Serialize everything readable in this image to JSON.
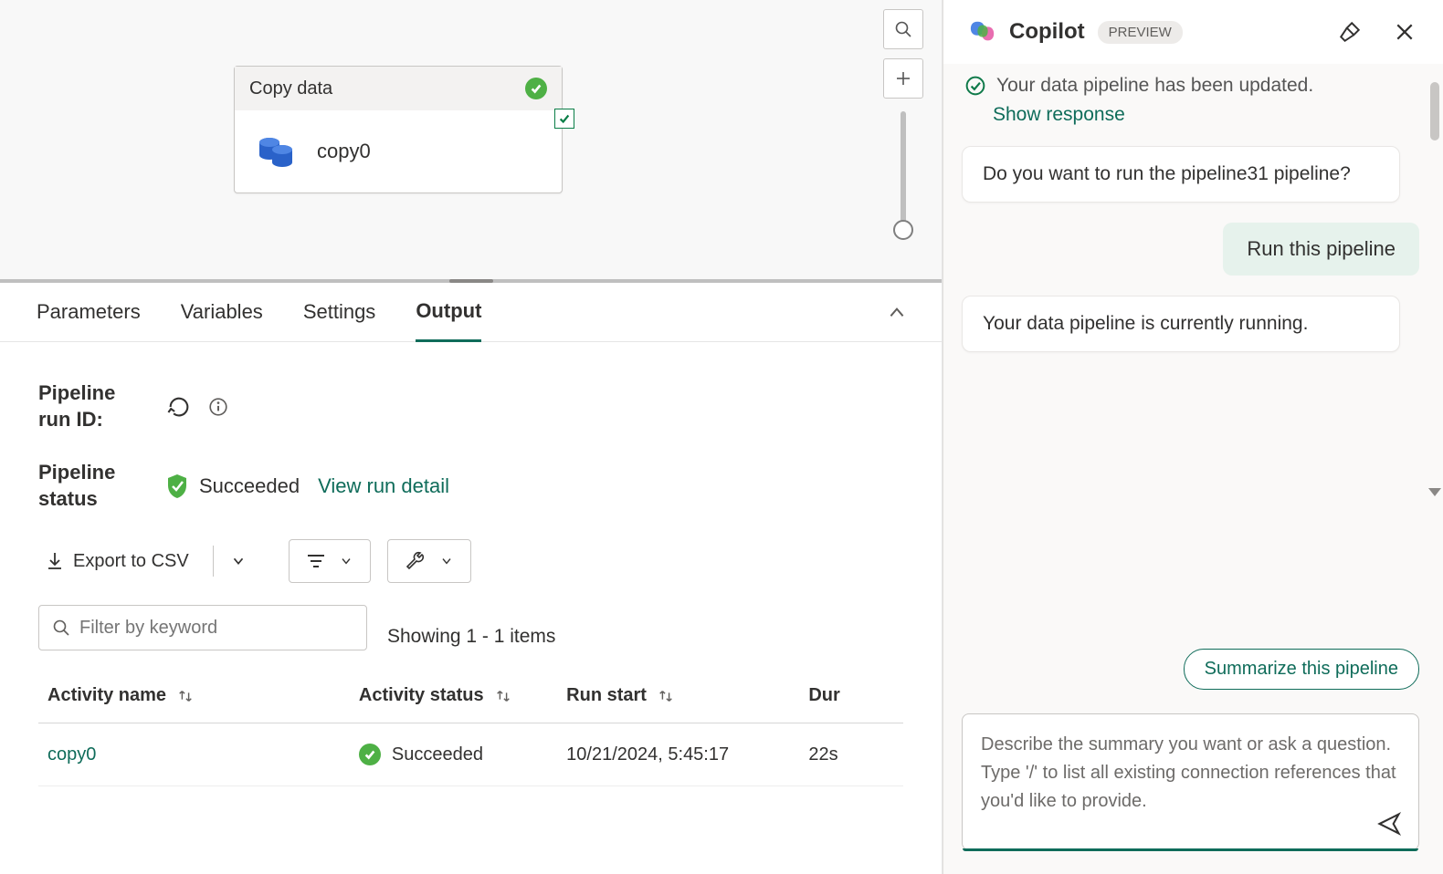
{
  "canvas": {
    "activity": {
      "header_label": "Copy data",
      "name": "copy0"
    }
  },
  "tabs": {
    "parameters": "Parameters",
    "variables": "Variables",
    "settings": "Settings",
    "output": "Output"
  },
  "output": {
    "run_id_label": "Pipeline run ID:",
    "status_label": "Pipeline status",
    "status_value": "Succeeded",
    "view_run_detail": "View run detail",
    "export_csv": "Export to CSV",
    "filter_placeholder": "Filter by keyword",
    "showing_count": "Showing 1 - 1 items",
    "columns": {
      "activity_name": "Activity name",
      "activity_status": "Activity status",
      "run_start": "Run start",
      "duration": "Dur"
    },
    "rows": [
      {
        "name": "copy0",
        "status": "Succeeded",
        "run_start": "10/21/2024, 5:45:17",
        "duration": "22s"
      }
    ]
  },
  "copilot": {
    "title": "Copilot",
    "preview": "PREVIEW",
    "clipped_status": "Your data pipeline has been updated.",
    "show_response": "Show response",
    "bot_msg_1": "Do you want to run the pipeline31 pipeline?",
    "user_msg_1": "Run this pipeline",
    "bot_msg_2": "Your data pipeline is currently running.",
    "suggestion": "Summarize this pipeline",
    "composer_placeholder": "Describe the summary you want or ask a question.\nType '/' to list all existing connection references that you'd like to provide."
  }
}
